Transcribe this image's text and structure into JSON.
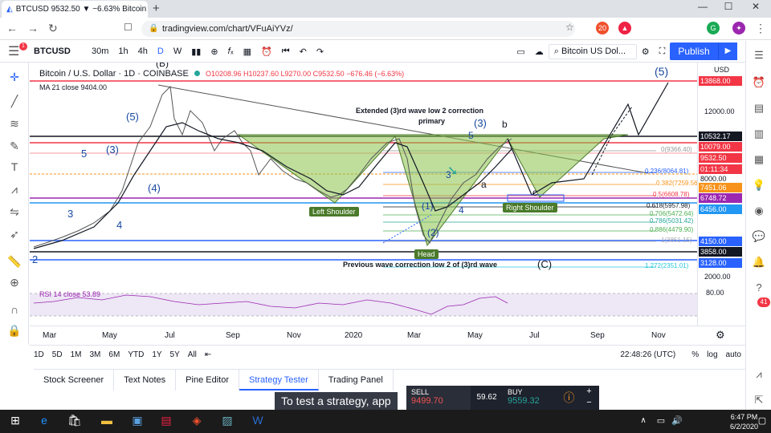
{
  "browser": {
    "tab_title": "BTCUSD 9532.50 ▼ −6.63% Bitcoin",
    "new_tab": "+",
    "url": "tradingview.com/chart/VFuAiYVz/",
    "window_controls": [
      "—",
      "☐",
      "✕"
    ],
    "ext_badges": [
      {
        "label": "20",
        "color": "#f0502d"
      },
      {
        "label": "G",
        "color": "#1aaa55"
      },
      {
        "label": "B",
        "color": "#e0453a"
      }
    ]
  },
  "toolbar": {
    "symbol": "BTCUSD",
    "intervals": [
      "30m",
      "1h",
      "4h",
      "D",
      "W"
    ],
    "active_interval": "D",
    "search_placeholder": "Bitcoin US Dol...",
    "publish": "Publish"
  },
  "legend": {
    "title": "Bitcoin / U.S. Dollar · 1D · COINBASE",
    "ohlc": "O10208.96 H10237.60 L9270.00 C9532.50 −676.46 (−6.63%)",
    "ma": "MA 21 close  9404.00",
    "rsi": "RSI 14 close  53.89"
  },
  "annotations": {
    "extended": "Extended (3)rd wave low 2 correction",
    "primary": "primary",
    "previous": "Previous wave correction low 2 of (3)rd wave",
    "left_shoulder": "Left Shoulder",
    "head": "Head",
    "right_shoulder": "Right Shoulder",
    "w5a": "(5)",
    "w5b": "5",
    "w3a": "(3)",
    "w4a": "(4)",
    "w3b": "3",
    "w4b": "4",
    "w2": "2",
    "w3c": "(3)",
    "wb": "b",
    "wa": "a",
    "wc": "c",
    "wC": "(C)",
    "w5top": "(5)",
    "w1p": "(1)",
    "w2p": "(2)",
    "w3m": "3",
    "w4m": "4",
    "w5m": "5",
    "wB": "(B)"
  },
  "fib_labels": [
    "0(9366.40)",
    "0.236(8064.81)",
    "0.382(7259.56)",
    "0.5(6608.78)",
    "0.618(5957.98)",
    "0.706(5472.64)",
    "0.786(5031.42)",
    "0.886(4479.90)",
    "1(3851.15)",
    "1.272(2351.01)"
  ],
  "price_axis": {
    "currency": "USD",
    "ticks": [
      "12000.00",
      "2000.00",
      "80.00"
    ],
    "labels": [
      {
        "text": "13868.00",
        "color": "#f23645"
      },
      {
        "text": "10532.17",
        "color": "#131722"
      },
      {
        "text": "10079.00",
        "color": "#f23645"
      },
      {
        "text": "9532.50",
        "color": "#f23645"
      },
      {
        "text": "01:11:34",
        "color": "#f23645"
      },
      {
        "text": "8000.00",
        "color": "#ffffff"
      },
      {
        "text": "7451.06",
        "color": "#f7931a"
      },
      {
        "text": "6748.72",
        "color": "#9c27b0"
      },
      {
        "text": "6456.00",
        "color": "#2196f3"
      },
      {
        "text": "4150.00",
        "color": "#2962ff"
      },
      {
        "text": "3858.00",
        "color": "#131722"
      },
      {
        "text": "3128.00",
        "color": "#2962ff"
      }
    ]
  },
  "time_axis": [
    "Mar",
    "May",
    "Jul",
    "Sep",
    "Nov",
    "2020",
    "Mar",
    "May",
    "Jul",
    "Sep",
    "Nov"
  ],
  "range_bar": {
    "ranges": [
      "1D",
      "5D",
      "1M",
      "3M",
      "6M",
      "YTD",
      "1Y",
      "5Y",
      "All"
    ],
    "time": "22:48:26 (UTC)",
    "pct": "%",
    "log": "log",
    "auto": "auto"
  },
  "bottom_tabs": [
    "Stock Screener",
    "Text Notes",
    "Pine Editor",
    "Strategy Tester",
    "Trading Panel"
  ],
  "active_bottom_tab": "Strategy Tester",
  "toast": "To test a strategy, app",
  "trade": {
    "sell_label": "SELL",
    "sell_price": "9499.70",
    "spread": "59.62",
    "buy_label": "BUY",
    "buy_price": "9559.32"
  },
  "taskbar": {
    "time": "6:47 PM",
    "date": "6/2/2020"
  },
  "badges": {
    "menu": "1",
    "right": "41"
  }
}
